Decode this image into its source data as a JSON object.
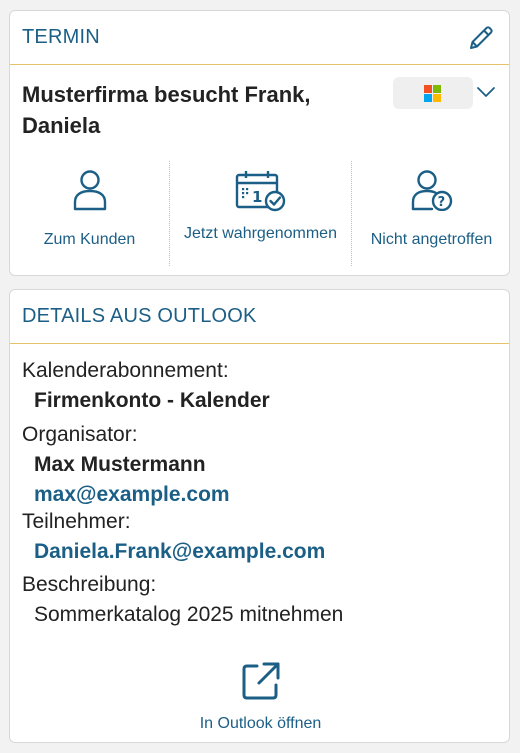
{
  "termin": {
    "title": "TERMIN",
    "subject": "Musterfirma besucht Frank, Daniela",
    "actions": [
      {
        "label": "Zum Kunden",
        "icon": "person-icon"
      },
      {
        "label": "Jetzt wahrgenommen",
        "icon": "calendar-check-icon"
      },
      {
        "label": "Nicht angetroffen",
        "icon": "person-question-icon"
      }
    ]
  },
  "details": {
    "title": "DETAILS AUS OUTLOOK",
    "calendar_label": "Kalenderabonnement:",
    "calendar_value": "Firmenkonto - Kalender",
    "organizer_label": "Organisator:",
    "organizer_name": "Max Mustermann",
    "organizer_email": "max@example.com",
    "participants_label": "Teilnehmer:",
    "participant_email": "Daniela.Frank@example.com",
    "description_label": "Beschreibung:",
    "description_value": "Sommerkatalog 2025 mitnehmen",
    "open_label": "In Outlook öffnen"
  },
  "colors": {
    "accent": "#1c5f86",
    "divider": "#e3c46a",
    "ms_red": "#f25022",
    "ms_green": "#7fba00",
    "ms_blue": "#00a4ef",
    "ms_yellow": "#ffb900"
  }
}
